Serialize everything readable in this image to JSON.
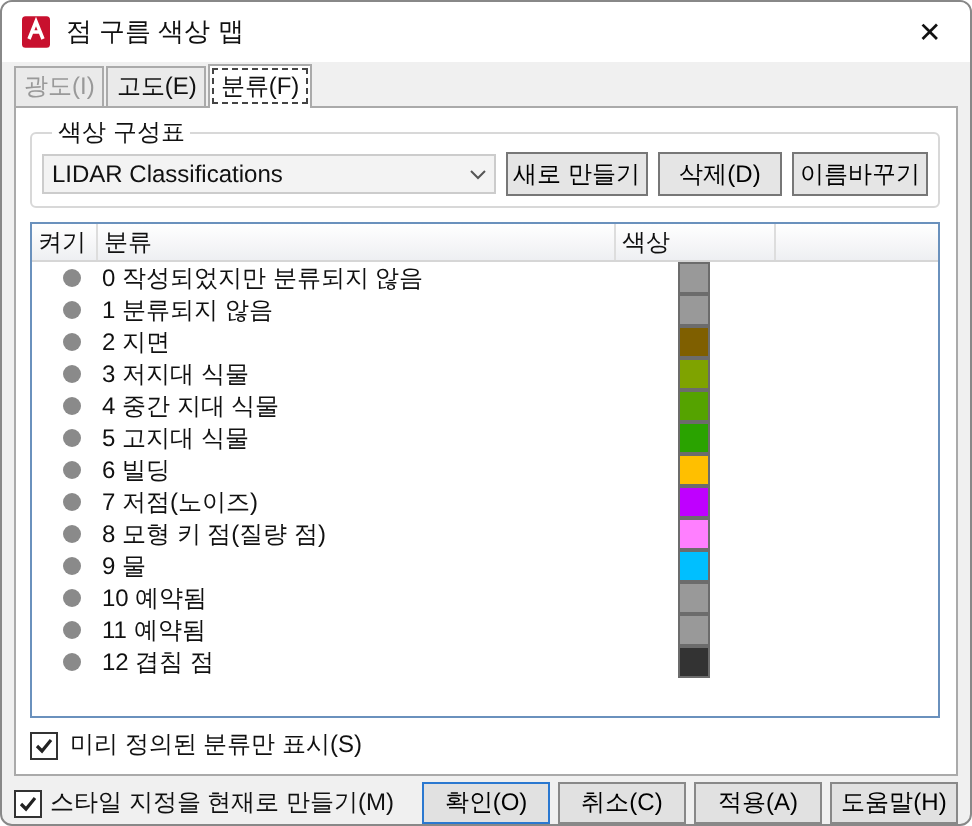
{
  "window": {
    "title": "점 구름 색상 맵",
    "close": "✕"
  },
  "tabs": [
    {
      "label": "광도(I)",
      "selected": false,
      "disabled": true
    },
    {
      "label": "고도(E)",
      "selected": false,
      "disabled": false
    },
    {
      "label": "분류(F)",
      "selected": true,
      "disabled": false
    }
  ],
  "scheme": {
    "legend": "색상 구성표",
    "value": "LIDAR Classifications",
    "buttons": [
      "새로 만들기",
      "삭제(D)",
      "이름바꾸기"
    ]
  },
  "table": {
    "columns": [
      "켜기",
      "분류",
      "색상"
    ],
    "rows": [
      {
        "name": "0 작성되었지만 분류되지 않음",
        "color": "#999999"
      },
      {
        "name": "1 분류되지 않음",
        "color": "#999999"
      },
      {
        "name": "2 지면",
        "color": "#7f5f00"
      },
      {
        "name": "3 저지대 식물",
        "color": "#7fa300"
      },
      {
        "name": "4 중간 지대 식물",
        "color": "#55a300"
      },
      {
        "name": "5 고지대 식물",
        "color": "#2aa300"
      },
      {
        "name": "6 빌딩",
        "color": "#ffbf00"
      },
      {
        "name": "7 저점(노이즈)",
        "color": "#bf00ff"
      },
      {
        "name": "8 모형 키 점(질량 점)",
        "color": "#ff7fff"
      },
      {
        "name": "9 물",
        "color": "#00bfff"
      },
      {
        "name": "10 예약됨",
        "color": "#999999"
      },
      {
        "name": "11 예약됨",
        "color": "#999999"
      },
      {
        "name": "12 겹침 점",
        "color": "#333333"
      }
    ]
  },
  "predefined_only": {
    "label": "미리 정의된 분류만 표시(S)",
    "checked": true
  },
  "make_current": {
    "label": "스타일 지정을 현재로 만들기(M)",
    "checked": true
  },
  "buttons": [
    {
      "label": "확인(O)",
      "selected": true
    },
    {
      "label": "취소(C)",
      "selected": false
    },
    {
      "label": "적용(A)",
      "selected": false
    },
    {
      "label": "도움말(H)",
      "selected": false
    }
  ]
}
